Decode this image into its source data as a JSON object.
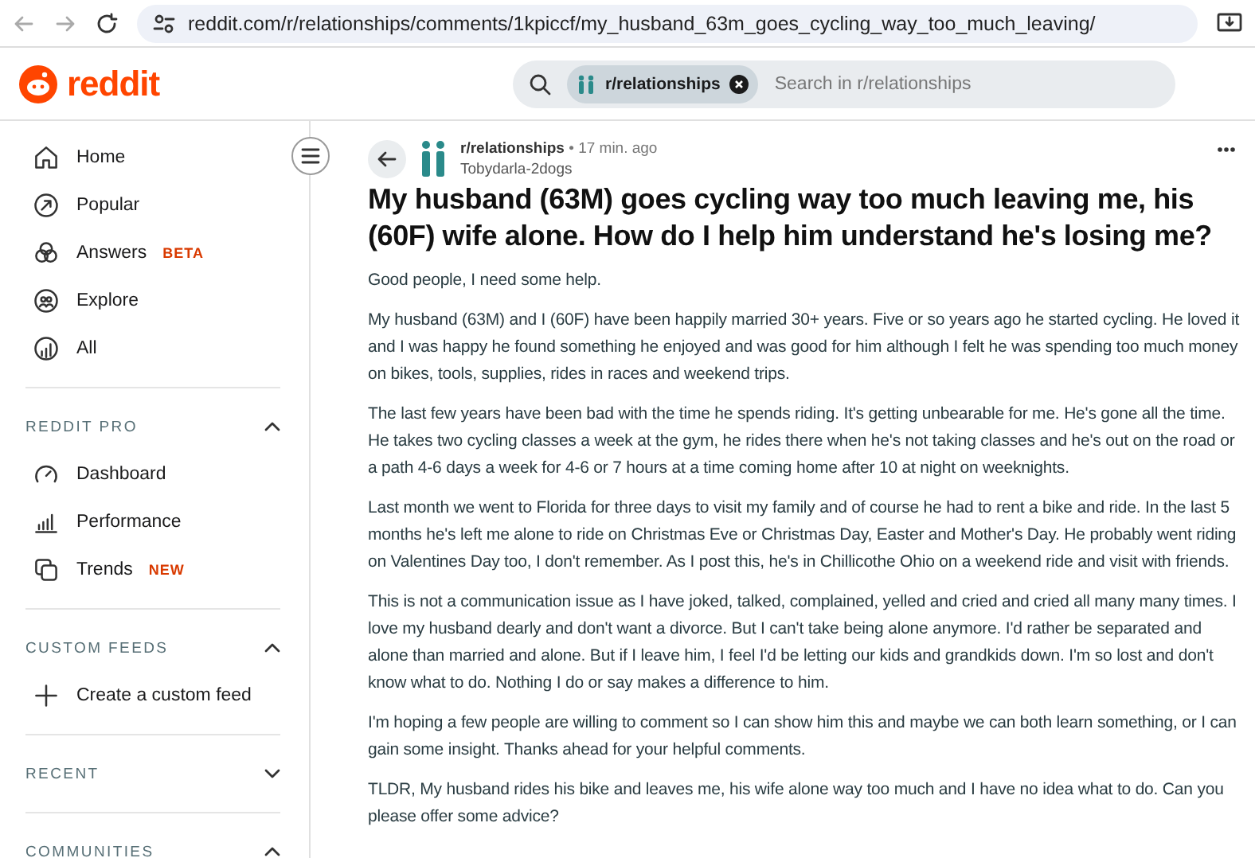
{
  "browser": {
    "url": "reddit.com/r/relationships/comments/1kpiccf/my_husband_63m_goes_cycling_way_too_much_leaving/"
  },
  "header": {
    "logo": "reddit",
    "search": {
      "chip": "r/relationships",
      "placeholder": "Search in r/relationships"
    }
  },
  "sidebar": {
    "items": [
      {
        "label": "Home"
      },
      {
        "label": "Popular"
      },
      {
        "label": "Answers",
        "badge": "BETA"
      },
      {
        "label": "Explore"
      },
      {
        "label": "All"
      }
    ],
    "sections": [
      {
        "title": "REDDIT PRO",
        "expanded": true,
        "items": [
          {
            "label": "Dashboard"
          },
          {
            "label": "Performance"
          },
          {
            "label": "Trends",
            "badge": "NEW"
          }
        ]
      },
      {
        "title": "CUSTOM FEEDS",
        "expanded": true,
        "items": [
          {
            "label": "Create a custom feed"
          }
        ]
      },
      {
        "title": "RECENT",
        "expanded": false
      },
      {
        "title": "COMMUNITIES",
        "expanded": true
      }
    ]
  },
  "post": {
    "subreddit": "r/relationships",
    "time": "• 17 min. ago",
    "author": "Tobydarla-2dogs",
    "title": "My husband (63M) goes cycling way too much leaving me, his (60F) wife alone. How do I help him understand he's losing me?",
    "paragraphs": [
      "Good people, I need some help.",
      "My husband (63M) and I (60F) have been happily married 30+ years. Five or so years ago he started cycling. He loved it and I was happy he found something he enjoyed and was good for him although I felt he was spending too much money on bikes, tools, supplies, rides in races and weekend trips.",
      "The last few years have been bad with the time he spends riding. It's getting unbearable for me. He's gone all the time. He takes two cycling classes a week at the gym, he rides there when he's not taking classes and he's out on the road or a path 4-6 days a week for 4-6 or 7 hours at a time coming home after 10 at night on weeknights.",
      "Last month we went to Florida for three days to visit my family and of course he had to rent a bike and ride. In the last 5 months he's left me alone to ride on Christmas Eve or Christmas Day, Easter and Mother's Day. He probably went riding on Valentines Day too, I don't remember. As I post this, he's in Chillicothe Ohio on a weekend ride and visit with friends.",
      "This is not a communication issue as I have joked, talked, complained, yelled and cried and cried all many many times. I love my husband dearly and don't want a divorce. But I can't take being alone anymore. I'd rather be separated and alone than married and alone. But if I leave him, I feel I'd be letting our kids and grandkids down. I'm so lost and don't know what to do. Nothing I do or say makes a difference to him.",
      "I'm hoping a few people are willing to comment so I can show him this and maybe we can both learn something, or I can gain some insight. Thanks ahead for your helpful comments.",
      "TLDR, My husband rides his bike and leaves me, his wife alone way too much and I have no idea what to do. Can you please offer some advice?"
    ]
  }
}
